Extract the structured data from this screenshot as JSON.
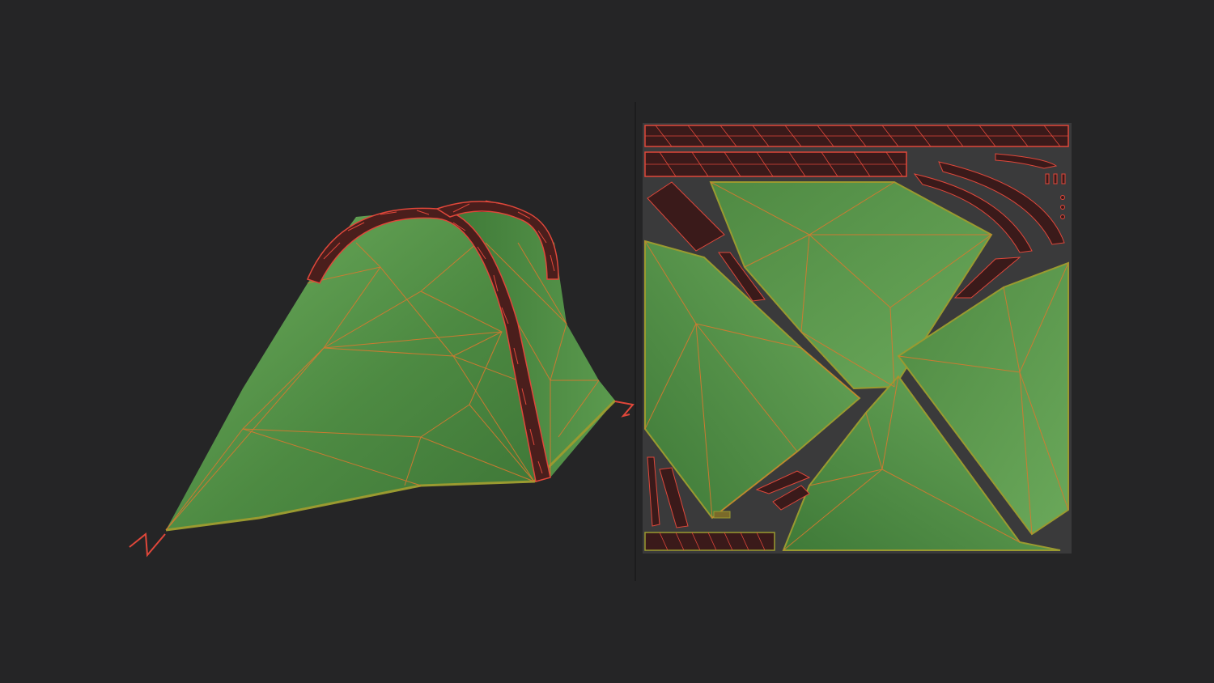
{
  "colors": {
    "background": "#252526",
    "divider": "#1c1c1d",
    "uv_canvas": "#3a3a3b",
    "fabric_light": "#6aa85a",
    "fabric_mid": "#4f8a43",
    "fabric_dark": "#2f5a2a",
    "wire_red": "#e0473a",
    "wire_orange": "#d9782f",
    "pole_dark": "#3a1a1a",
    "seam_yellow": "#9a9a30"
  },
  "panels": {
    "model_view": {
      "subject": "tent-3d-model",
      "overlay": "wireframe"
    },
    "uv_view": {
      "subject": "tent-uv-layout",
      "overlay": "wireframe"
    }
  }
}
